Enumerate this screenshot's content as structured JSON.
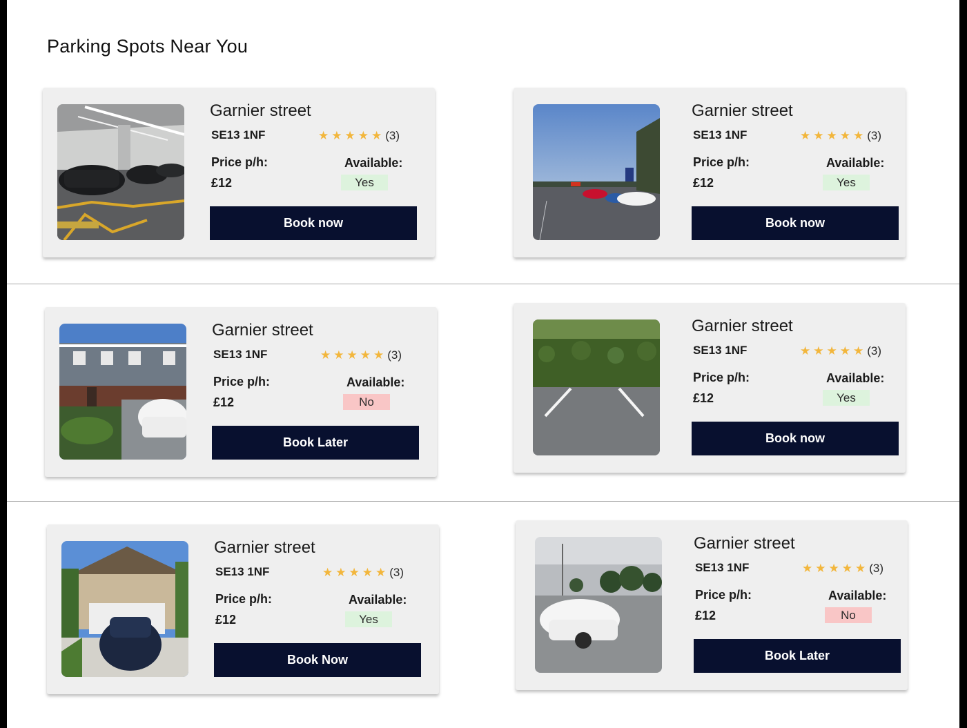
{
  "page": {
    "title": "Parking Spots Near You"
  },
  "colors": {
    "button": "#08102f",
    "star": "#f2b63c",
    "available_yes": "#ddf3dd",
    "available_no": "#f9c6c6",
    "card": "#efefef"
  },
  "cards": [
    {
      "street": "Garnier street",
      "postcode": "SE13 1NF",
      "stars": "★★★★★",
      "rating_count": "(3)",
      "price_label": "Price p/h:",
      "price": "£12",
      "available_label": "Available:",
      "available": "Yes",
      "button": "Book now",
      "photo": "indoor-garage-photo"
    },
    {
      "street": "Garnier street",
      "postcode": "SE13 1NF",
      "stars": "★★★★★",
      "rating_count": "(3)",
      "price_label": "Price p/h:",
      "price": "£12",
      "available_label": "Available:",
      "available": "Yes",
      "button": "Book now",
      "photo": "outdoor-lot-dusk-photo"
    },
    {
      "street": "Garnier street",
      "postcode": "SE13 1NF",
      "stars": "★★★★★",
      "rating_count": "(3)",
      "price_label": "Price p/h:",
      "price": "£12",
      "available_label": "Available:",
      "available": "No",
      "button": "Book Later",
      "photo": "house-driveway-photo"
    },
    {
      "street": "Garnier street",
      "postcode": "SE13 1NF",
      "stars": "★★★★★",
      "rating_count": "(3)",
      "price_label": "Price p/h:",
      "price": "£12",
      "available_label": "Available:",
      "available": "Yes",
      "button": "Book now",
      "photo": "hedge-parking-bay-photo"
    },
    {
      "street": "Garnier street",
      "postcode": "SE13 1NF",
      "stars": "★★★★★",
      "rating_count": "(3)",
      "price_label": "Price p/h:",
      "price": "£12",
      "available_label": "Available:",
      "available": "Yes",
      "button": "Book Now",
      "photo": "garage-driveway-suv-photo"
    },
    {
      "street": "Garnier street",
      "postcode": "SE13 1NF",
      "stars": "★★★★★",
      "rating_count": "(3)",
      "price_label": "Price p/h:",
      "price": "£12",
      "available_label": "Available:",
      "available": "No",
      "button": "Book Later",
      "photo": "street-lot-white-car-photo"
    }
  ]
}
